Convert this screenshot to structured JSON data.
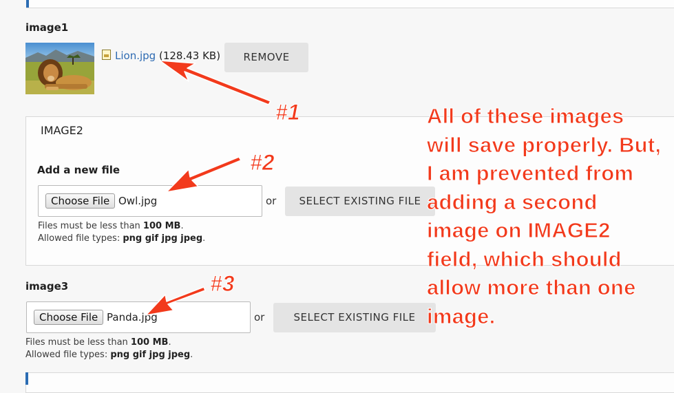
{
  "image1": {
    "label": "image1",
    "file": {
      "name": "Lion.jpg",
      "size": "(128.43 KB)",
      "icon": "image-file-icon"
    },
    "remove_label": "REMOVE"
  },
  "image2": {
    "legend": "IMAGE2",
    "add_label": "Add a new file",
    "choose_label": "Choose File",
    "chosen_file": "Owl.jpg",
    "or": "or",
    "select_existing_label": "SELECT EXISTING FILE",
    "help_size_prefix": "Files must be less than ",
    "help_size_value": "100 MB",
    "help_size_suffix": ".",
    "help_types_prefix": "Allowed file types: ",
    "help_types_value": "png gif jpg jpeg",
    "help_types_suffix": "."
  },
  "image3": {
    "label": "image3",
    "choose_label": "Choose File",
    "chosen_file": "Panda.jpg",
    "or": "or",
    "select_existing_label": "SELECT EXISTING FILE",
    "help_size_prefix": "Files must be less than ",
    "help_size_value": "100 MB",
    "help_size_suffix": ".",
    "help_types_prefix": "Allowed file types: ",
    "help_types_value": "png gif jpg jpeg",
    "help_types_suffix": "."
  },
  "annotations": {
    "num1": "#1",
    "num2": "#2",
    "num3": "#3",
    "lines": [
      "All of these images",
      "will save properly. But,",
      "I am prevented from",
      "adding a second",
      "image on IMAGE2",
      "field, which should",
      "allow more than one",
      "image."
    ],
    "color": "#f23a1c"
  },
  "colors": {
    "link": "#2d6ab2",
    "accent": "#2b6cb3",
    "button_bg": "#e4e4e4"
  }
}
